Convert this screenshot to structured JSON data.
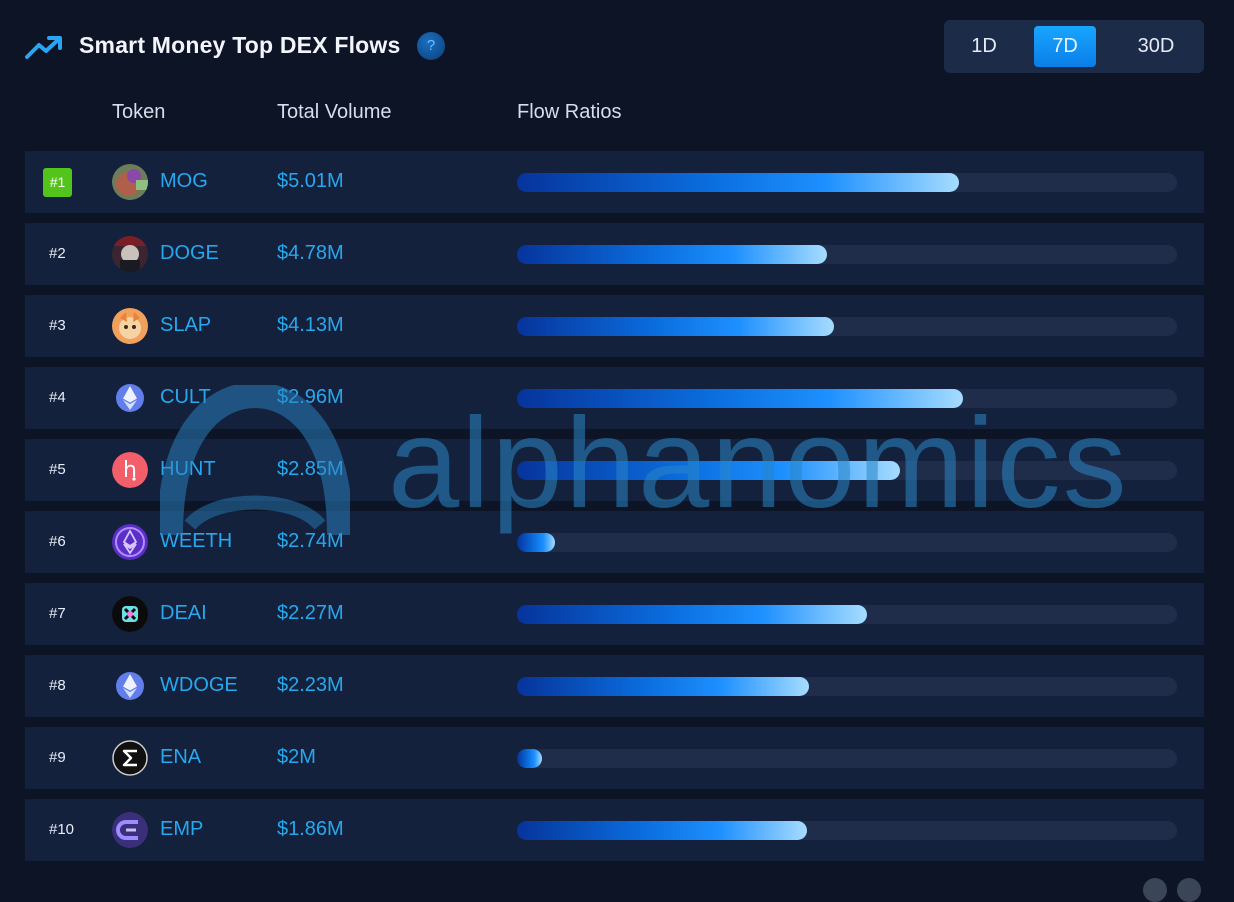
{
  "header": {
    "title": "Smart Money Top DEX Flows",
    "help_label": "?",
    "tabs": [
      {
        "label": "1D",
        "active": false
      },
      {
        "label": "7D",
        "active": true
      },
      {
        "label": "30D",
        "active": false
      }
    ]
  },
  "columns": {
    "token": "Token",
    "volume": "Total Volume",
    "flow": "Flow Ratios"
  },
  "rows": [
    {
      "rank": "#1",
      "symbol": "MOG",
      "volume": "$5.01M",
      "flow_ratio": 0.67,
      "icon": "mog-token-icon"
    },
    {
      "rank": "#2",
      "symbol": "DOGE",
      "volume": "$4.78M",
      "flow_ratio": 0.47,
      "icon": "doge-token-icon"
    },
    {
      "rank": "#3",
      "symbol": "SLAP",
      "volume": "$4.13M",
      "flow_ratio": 0.48,
      "icon": "slap-token-icon"
    },
    {
      "rank": "#4",
      "symbol": "CULT",
      "volume": "$2.96M",
      "flow_ratio": 0.675,
      "icon": "ethereum-icon"
    },
    {
      "rank": "#5",
      "symbol": "HUNT",
      "volume": "$2.85M",
      "flow_ratio": 0.58,
      "icon": "hunt-token-icon"
    },
    {
      "rank": "#6",
      "symbol": "WEETH",
      "volume": "$2.74M",
      "flow_ratio": 0.057,
      "icon": "weeth-token-icon"
    },
    {
      "rank": "#7",
      "symbol": "DEAI",
      "volume": "$2.27M",
      "flow_ratio": 0.53,
      "icon": "deai-token-icon"
    },
    {
      "rank": "#8",
      "symbol": "WDOGE",
      "volume": "$2.23M",
      "flow_ratio": 0.443,
      "icon": "ethereum-icon"
    },
    {
      "rank": "#9",
      "symbol": "ENA",
      "volume": "$2M",
      "flow_ratio": 0.038,
      "icon": "ena-token-icon"
    },
    {
      "rank": "#10",
      "symbol": "EMP",
      "volume": "$1.86M",
      "flow_ratio": 0.44,
      "icon": "emp-token-icon"
    }
  ],
  "watermark": "alphanomics",
  "colors": {
    "background": "#0c1426",
    "row_background": "#14213d",
    "accent": "#27a8ee",
    "active_tab": "#0a8ff0",
    "rank_badge": "#52c41a"
  }
}
